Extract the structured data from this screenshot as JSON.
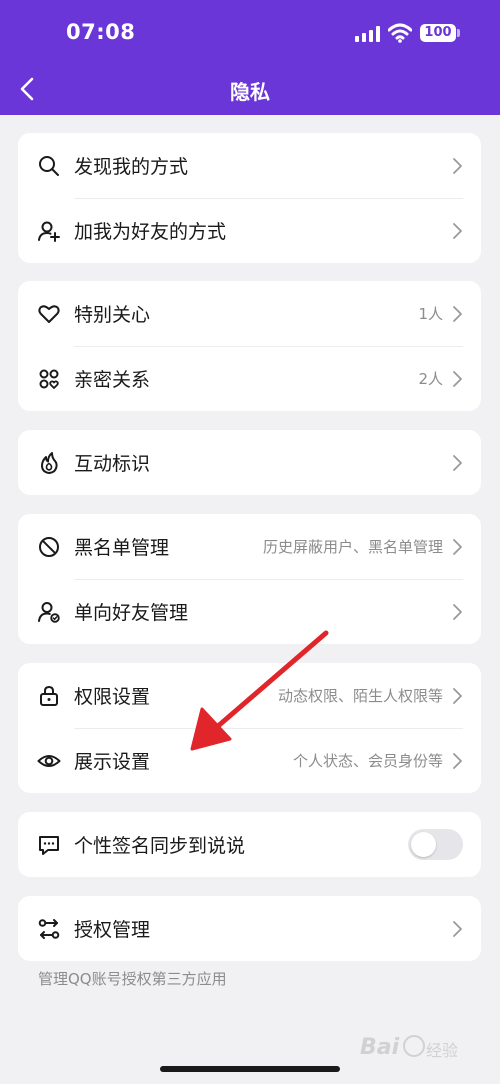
{
  "status_bar": {
    "time": "07:08",
    "battery": "100"
  },
  "nav": {
    "title": "隐私"
  },
  "groups": [
    {
      "rows": [
        {
          "label": "发现我的方式",
          "value": "",
          "icon": "search-icon"
        },
        {
          "label": "加我为好友的方式",
          "value": "",
          "icon": "add-user-icon"
        }
      ]
    },
    {
      "rows": [
        {
          "label": "特别关心",
          "value": "1人",
          "icon": "heart-icon"
        },
        {
          "label": "亲密关系",
          "value": "2人",
          "icon": "intimate-icon"
        }
      ]
    },
    {
      "rows": [
        {
          "label": "互动标识",
          "value": "",
          "icon": "flame-icon"
        }
      ]
    },
    {
      "rows": [
        {
          "label": "黑名单管理",
          "value": "历史屏蔽用户、黑名单管理",
          "icon": "block-icon"
        },
        {
          "label": "单向好友管理",
          "value": "",
          "icon": "user-gear-icon"
        }
      ]
    },
    {
      "rows": [
        {
          "label": "权限设置",
          "value": "动态权限、陌生人权限等",
          "icon": "lock-icon"
        },
        {
          "label": "展示设置",
          "value": "个人状态、会员身份等",
          "icon": "eye-icon"
        }
      ]
    },
    {
      "rows": [
        {
          "label": "个性签名同步到说说",
          "icon": "message-icon",
          "toggle_on": false
        }
      ]
    },
    {
      "rows": [
        {
          "label": "授权管理",
          "value": "",
          "icon": "authorize-icon"
        }
      ]
    }
  ],
  "footnote": "管理QQ账号授权第三方应用",
  "watermark": "Bai du 经验",
  "colors": {
    "header": "#6a36d8",
    "background": "#f1f1f4",
    "annotation_arrow": "#e0262b"
  }
}
